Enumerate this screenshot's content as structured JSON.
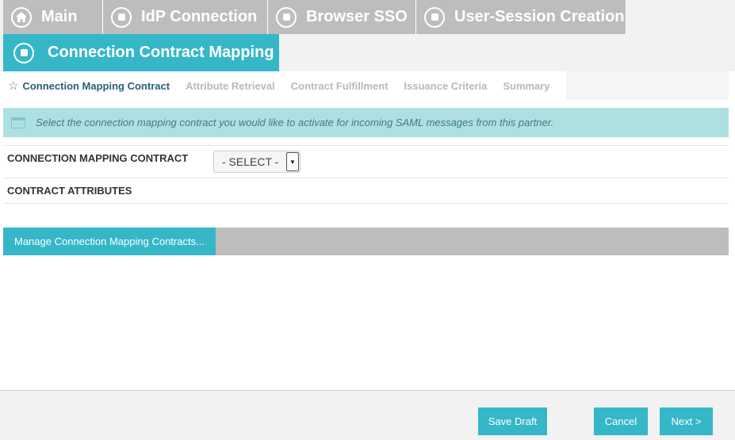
{
  "breadcrumbs": {
    "main": "Main",
    "idp_connection": "IdP Connection",
    "browser_sso": "Browser SSO",
    "user_session": "User-Session Creation",
    "current": "Connection Contract Mapping"
  },
  "subtabs": [
    {
      "label": "Connection Mapping Contract",
      "active": true
    },
    {
      "label": "Attribute Retrieval",
      "active": false
    },
    {
      "label": "Contract Fulfillment",
      "active": false
    },
    {
      "label": "Issuance Criteria",
      "active": false
    },
    {
      "label": "Summary",
      "active": false
    }
  ],
  "info_message": "Select the connection mapping contract you would like to activate for incoming SAML messages from this partner.",
  "form": {
    "mapping_contract_label": "CONNECTION MAPPING CONTRACT",
    "mapping_contract_value": "- SELECT -",
    "contract_attributes_label": "CONTRACT ATTRIBUTES"
  },
  "manage_button": "Manage Connection Mapping Contracts...",
  "footer": {
    "save_draft": "Save Draft",
    "cancel": "Cancel",
    "next": "Next >"
  },
  "colors": {
    "accent": "#35b7c8",
    "inactive_tab": "#bdbdbd",
    "info_bg": "#aee0e2"
  }
}
